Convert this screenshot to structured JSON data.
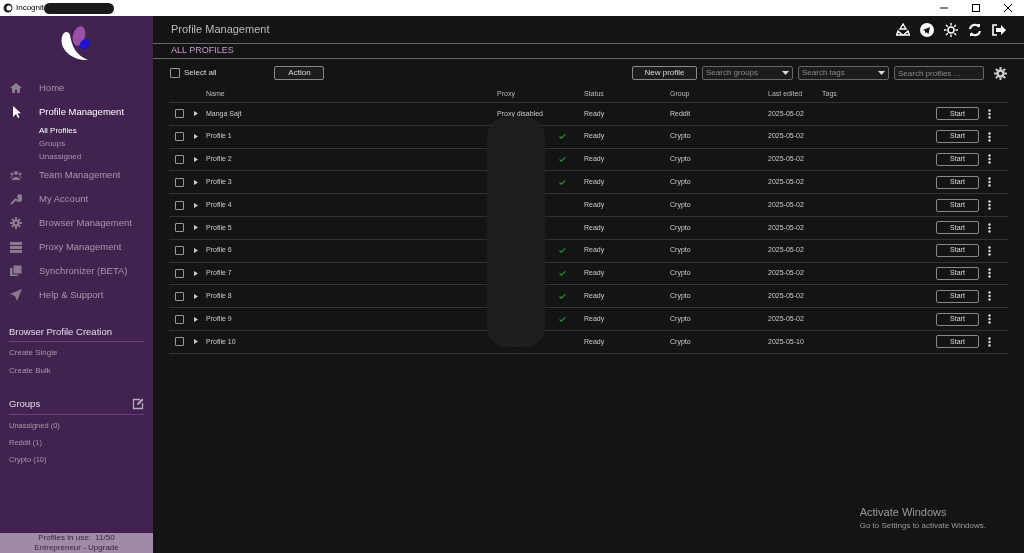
{
  "window": {
    "title": "Incognit"
  },
  "sidebar": {
    "nav": [
      {
        "label": "Home",
        "selected": false
      },
      {
        "label": "Profile Management",
        "selected": true,
        "children": [
          {
            "label": "All Profiles",
            "selected": true
          },
          {
            "label": "Groups",
            "selected": false
          },
          {
            "label": "Unassigned",
            "selected": false
          }
        ]
      },
      {
        "label": "Team Management",
        "selected": false
      },
      {
        "label": "My Account",
        "selected": false
      },
      {
        "label": "Browser Management",
        "selected": false
      },
      {
        "label": "Proxy Management",
        "selected": false
      },
      {
        "label": "Synchronizer (BETA)",
        "selected": false
      },
      {
        "label": "Help & Support",
        "selected": false
      }
    ],
    "creation": {
      "title": "Browser Profile Creation",
      "items": [
        "Create Single",
        "Create Bulk"
      ]
    },
    "groups": {
      "title": "Groups",
      "items": [
        "Unassigned (0)",
        "Reddit (1)",
        "Crypto (10)"
      ]
    },
    "footer": {
      "usage_label": "Profiles in use:",
      "usage": "11/50",
      "plan": "Entrepreneur - Upgrade"
    }
  },
  "header": {
    "title": "Profile Management"
  },
  "section_title": "ALL PROFILES",
  "toolbar": {
    "select_all": {
      "label": "Select all",
      "checked": false
    },
    "action": "Action",
    "new_profile": "New profile",
    "search_groups": {
      "placeholder": "Search groups"
    },
    "search_tags": {
      "placeholder": "Search tags"
    },
    "search_profiles": {
      "placeholder": "Search profiles ..."
    }
  },
  "table": {
    "columns": [
      "Name",
      "Proxy",
      "Status",
      "Group",
      "Last edited",
      "Tags"
    ],
    "rows": [
      {
        "checked": false,
        "name": "Manga Sajt",
        "proxy": "Proxy disabled",
        "proxy_ok": false,
        "status": "Ready",
        "group": "Reddit",
        "edited": "2025-05-02",
        "action": "Start"
      },
      {
        "checked": false,
        "name": "Profile 1",
        "proxy_ok": true,
        "status": "Ready",
        "group": "Crypto",
        "edited": "2025-05-02",
        "action": "Start"
      },
      {
        "checked": false,
        "name": "Profile 2",
        "proxy_ok": true,
        "status": "Ready",
        "group": "Crypto",
        "edited": "2025-05-02",
        "action": "Start"
      },
      {
        "checked": false,
        "name": "Profile 3",
        "proxy_ok": true,
        "status": "Ready",
        "group": "Crypto",
        "edited": "2025-05-02",
        "action": "Start"
      },
      {
        "checked": false,
        "name": "Profile 4",
        "proxy_ok": false,
        "status": "Ready",
        "group": "Crypto",
        "edited": "2025-05-02",
        "action": "Start"
      },
      {
        "checked": false,
        "name": "Profile 5",
        "proxy_ok": false,
        "status": "Ready",
        "group": "Crypto",
        "edited": "2025-05-02",
        "action": "Start"
      },
      {
        "checked": false,
        "name": "Profile 6",
        "proxy_ok": true,
        "status": "Ready",
        "group": "Crypto",
        "edited": "2025-05-02",
        "action": "Start"
      },
      {
        "checked": false,
        "name": "Profile 7",
        "proxy_ok": true,
        "status": "Ready",
        "group": "Crypto",
        "edited": "2025-05-02",
        "action": "Start"
      },
      {
        "checked": false,
        "name": "Profile 8",
        "proxy_ok": true,
        "status": "Ready",
        "group": "Crypto",
        "edited": "2025-05-02",
        "action": "Start"
      },
      {
        "checked": false,
        "name": "Profile 9",
        "proxy_ok": true,
        "status": "Ready",
        "group": "Crypto",
        "edited": "2025-05-02",
        "action": "Start"
      },
      {
        "checked": false,
        "name": "Profile 10",
        "proxy_ok": false,
        "status": "Ready",
        "group": "Crypto",
        "edited": "2025-05-10",
        "action": "Start"
      }
    ]
  },
  "os_notice": {
    "title": "Activate Windows",
    "text": "Go to Settings to activate Windows."
  }
}
